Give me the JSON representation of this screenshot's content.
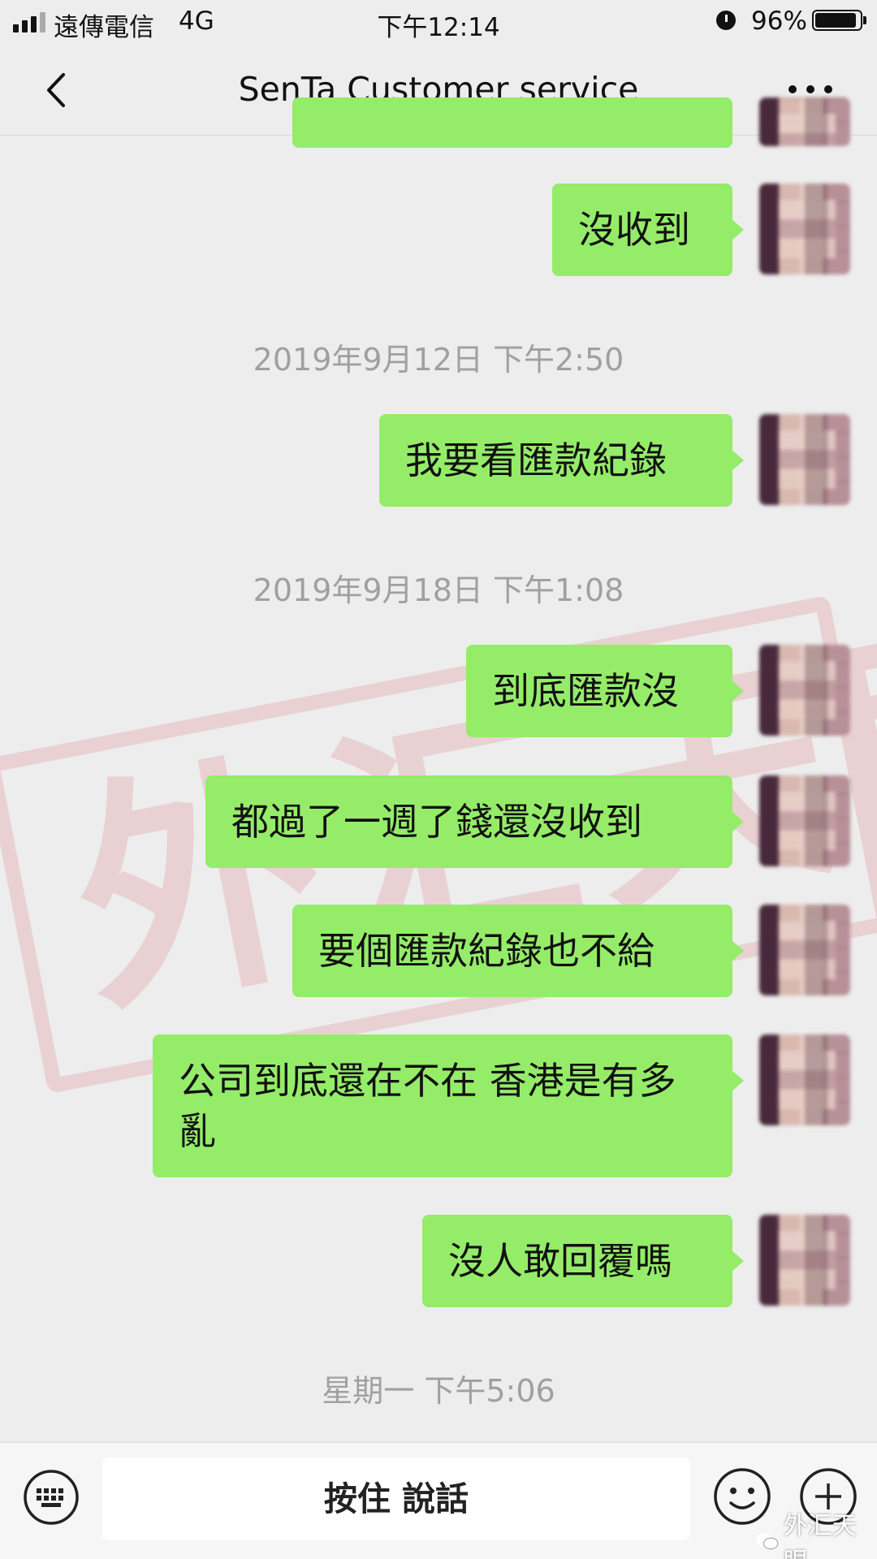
{
  "status_bar": {
    "carrier": "遠傳電信",
    "network": "4G",
    "time": "下午12:14",
    "battery": "96%"
  },
  "nav": {
    "title": "SenTa Customer service"
  },
  "messages": [
    {
      "type": "partial",
      "text": ""
    },
    {
      "type": "text",
      "text": "沒收到"
    },
    {
      "type": "timestamp",
      "text": "2019年9月12日 下午2:50"
    },
    {
      "type": "text",
      "text": "我要看匯款紀錄"
    },
    {
      "type": "timestamp",
      "text": "2019年9月18日 下午1:08"
    },
    {
      "type": "text",
      "text": "到底匯款沒"
    },
    {
      "type": "text",
      "text": "都過了一週了錢還沒收到"
    },
    {
      "type": "text",
      "text": "要個匯款紀錄也不給"
    },
    {
      "type": "text",
      "text": "公司到底還在不在 香港是有多亂"
    },
    {
      "type": "text",
      "text": "沒人敢回覆嗎"
    },
    {
      "type": "timestamp",
      "text": "星期一 下午5:06"
    }
  ],
  "stamp_watermark": "外汇天眼",
  "input_bar": {
    "hold_to_talk": "按住 說話"
  },
  "bottom_watermark": "外汇天眼",
  "colors": {
    "bubble": "#95ec69",
    "background": "#ededed",
    "stamp": "#d21f2b"
  },
  "icons": [
    "signal-icon",
    "alarm-icon",
    "battery-icon",
    "back-icon",
    "more-icon",
    "voice-toggle-icon",
    "emoji-icon",
    "add-icon"
  ]
}
